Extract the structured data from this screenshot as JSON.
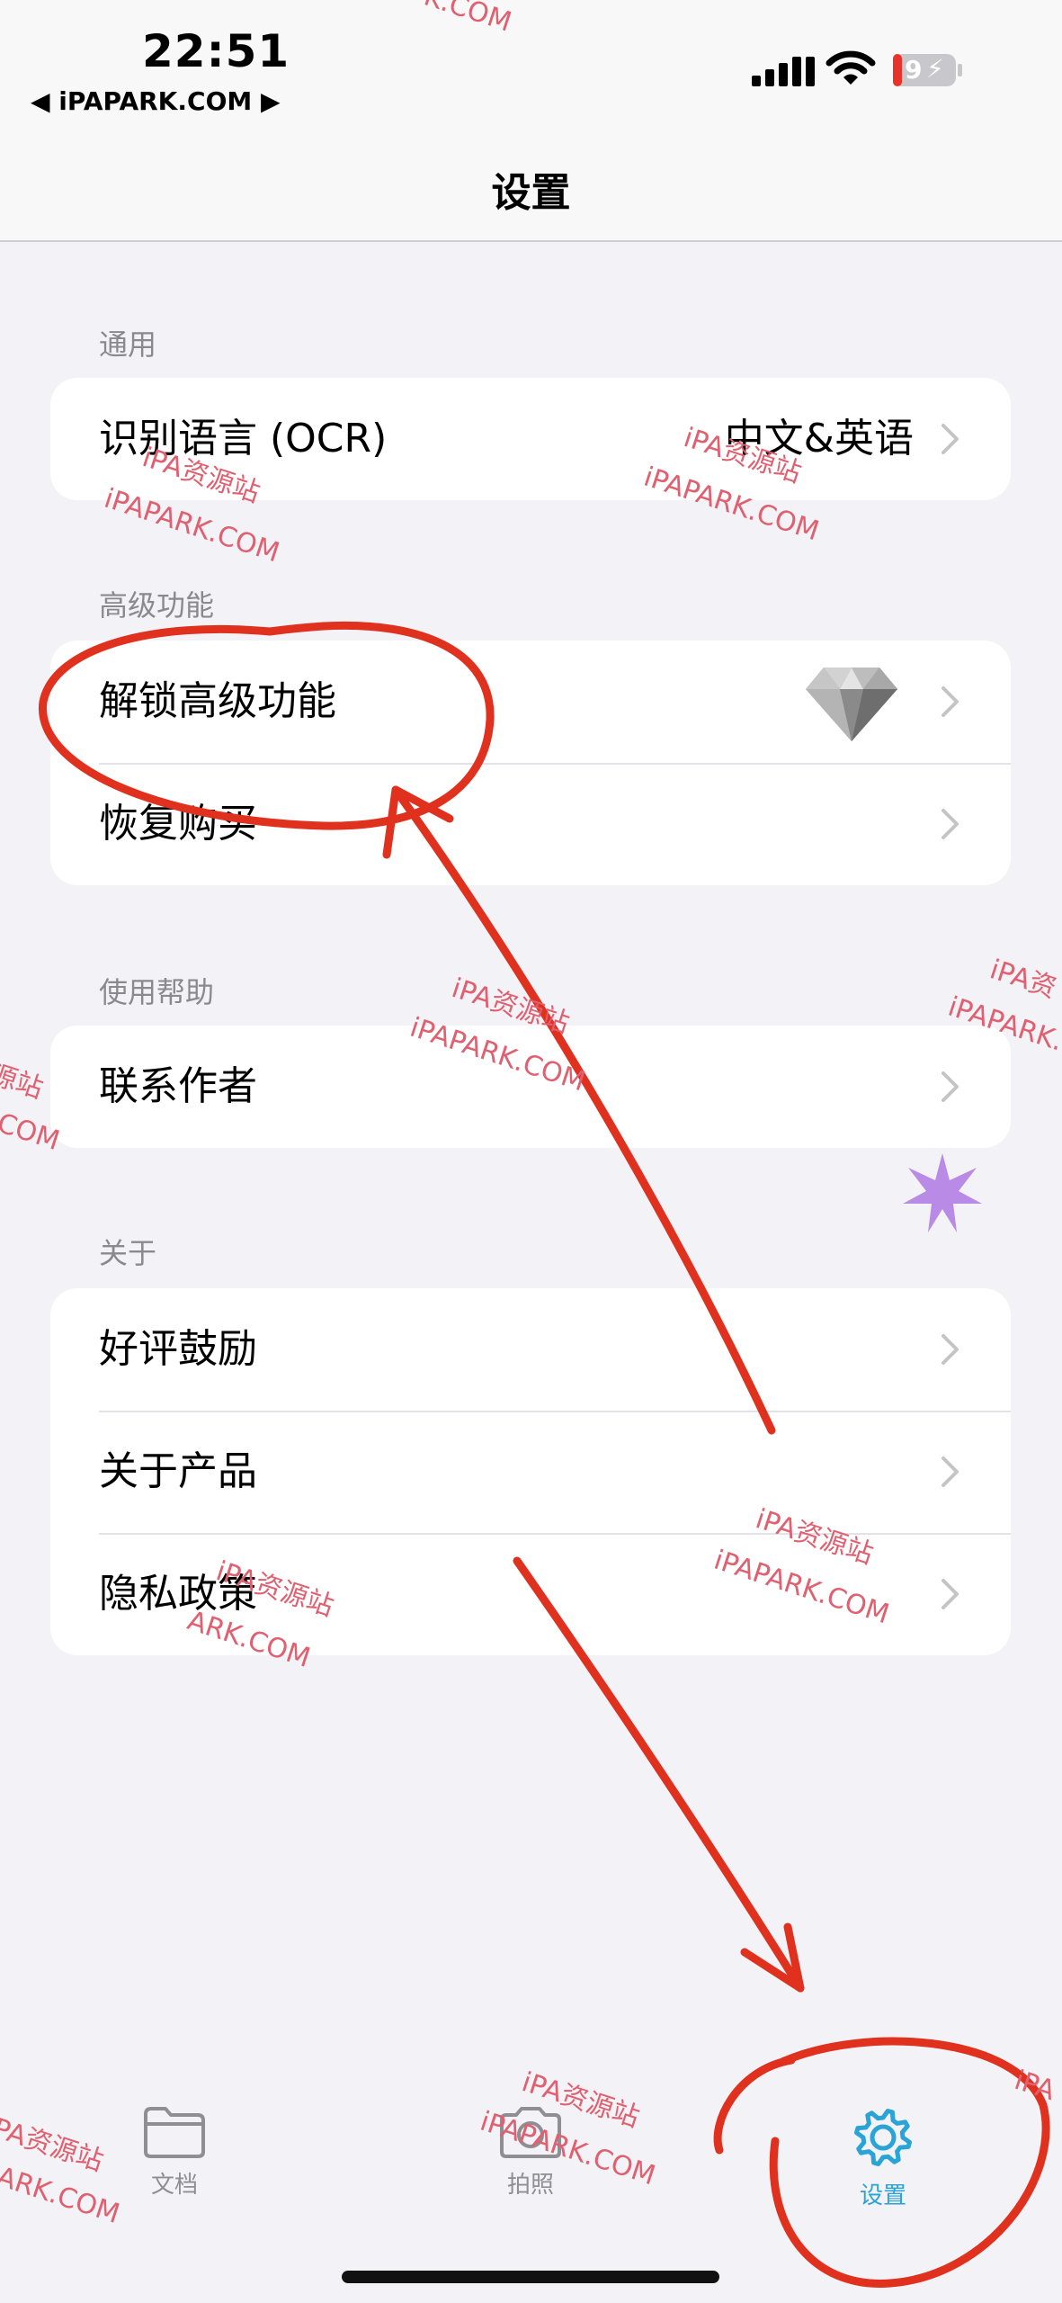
{
  "status_bar": {
    "time": "22:51",
    "back_label": "◀ iPAPARK.COM ▶",
    "battery": "9"
  },
  "nav": {
    "title": "设置"
  },
  "sections": [
    {
      "header": "通用",
      "items": [
        {
          "label": "识别语言 (OCR)",
          "value": "中文&英语"
        }
      ]
    },
    {
      "header": "高级功能",
      "items": [
        {
          "label": "解锁高级功能",
          "icon": "diamond-icon"
        },
        {
          "label": "恢复购买"
        }
      ]
    },
    {
      "header": "使用帮助",
      "items": [
        {
          "label": "联系作者"
        }
      ]
    },
    {
      "header": "关于",
      "items": [
        {
          "label": "好评鼓励"
        },
        {
          "label": "关于产品"
        },
        {
          "label": "隐私政策"
        }
      ]
    }
  ],
  "tabs": [
    {
      "label": "文档",
      "icon": "folder-icon",
      "active": false
    },
    {
      "label": "拍照",
      "icon": "camera-icon",
      "active": false
    },
    {
      "label": "设置",
      "icon": "gear-icon",
      "active": true
    }
  ],
  "watermarks": {
    "cn": "iPA资源站",
    "en": "iPAPARK.COM",
    "cn_partial_1": "iPA资",
    "en_partial_1": "iPAPARK.",
    "cn_partial_2": "源站",
    "en_partial_2": "COM",
    "cn_partial_3": "PA资源站",
    "en_partial_3": "ARK.COM",
    "en_top": "K.COM",
    "edge": "iPA"
  },
  "colors": {
    "accent": "#2aa3d6",
    "annotation": "#e0301e",
    "background": "#f2f2f7"
  }
}
